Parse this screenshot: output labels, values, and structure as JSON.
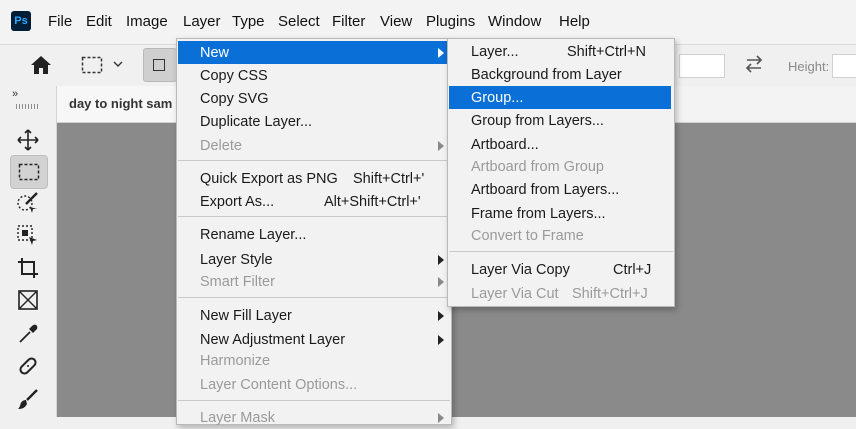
{
  "app": {
    "logo_text": "Ps"
  },
  "menubar": {
    "file": "File",
    "edit": "Edit",
    "image": "Image",
    "layer": "Layer",
    "type": "Type",
    "select": "Select",
    "filter": "Filter",
    "view": "View",
    "plugins": "Plugins",
    "window": "Window",
    "help": "Help"
  },
  "options_bar": {
    "height_label": "Height:"
  },
  "document": {
    "tab_title": "day to night sam"
  },
  "layer_menu": {
    "new": "New",
    "copy_css": "Copy CSS",
    "copy_svg": "Copy SVG",
    "duplicate_layer": "Duplicate Layer...",
    "delete": "Delete",
    "quick_export": "Quick Export as PNG",
    "quick_export_sc": "Shift+Ctrl+'",
    "export_as": "Export As...",
    "export_as_sc": "Alt+Shift+Ctrl+'",
    "rename_layer": "Rename Layer...",
    "layer_style": "Layer Style",
    "smart_filter": "Smart Filter",
    "new_fill_layer": "New Fill Layer",
    "new_adjustment_layer": "New Adjustment Layer",
    "harmonize": "Harmonize",
    "layer_content_options": "Layer Content Options...",
    "layer_mask": "Layer Mask"
  },
  "new_submenu": {
    "layer": "Layer...",
    "layer_sc": "Shift+Ctrl+N",
    "background_from_layer": "Background from Layer",
    "group": "Group...",
    "group_from_layers": "Group from Layers...",
    "artboard": "Artboard...",
    "artboard_from_group": "Artboard from Group",
    "artboard_from_layers": "Artboard from Layers...",
    "frame_from_layers": "Frame from Layers...",
    "convert_to_frame": "Convert to Frame",
    "layer_via_copy": "Layer Via Copy",
    "layer_via_copy_sc": "Ctrl+J",
    "layer_via_cut": "Layer Via Cut",
    "layer_via_cut_sc": "Shift+Ctrl+J"
  },
  "colors": {
    "highlight": "#0a6fd6",
    "canvas": "#8a8a8a",
    "logo_bg": "#001e36",
    "logo_fg": "#31a8ff"
  }
}
